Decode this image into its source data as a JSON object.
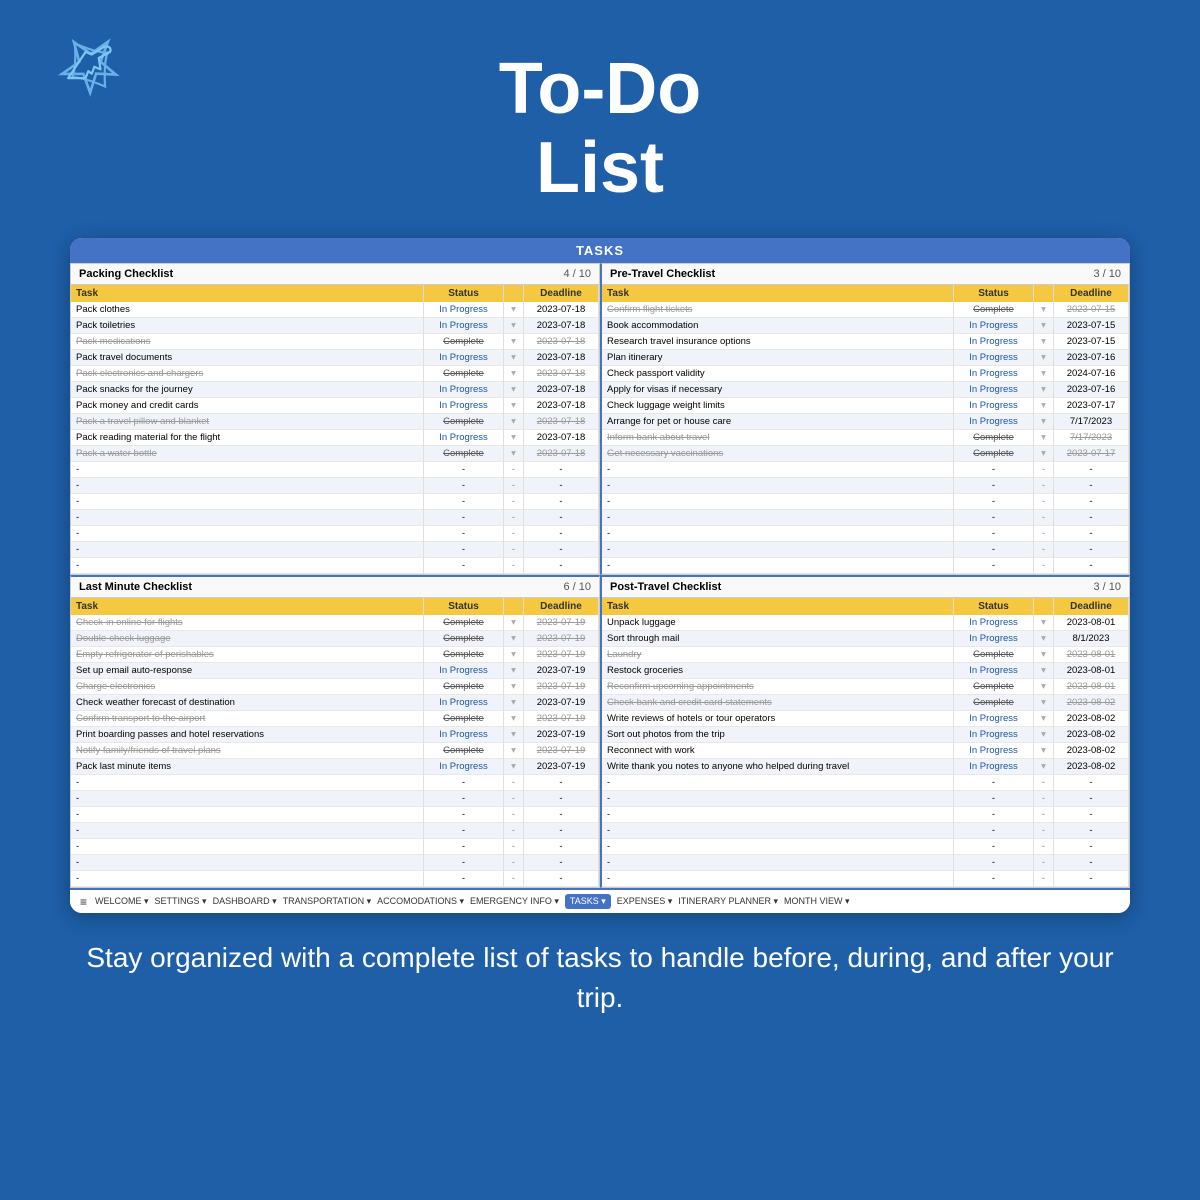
{
  "header": {
    "title_line1": "To-Do",
    "title_line2": "List"
  },
  "spreadsheet": {
    "title": "TASKS",
    "packing": {
      "label": "Packing Checklist",
      "count": "4 / 10",
      "columns": [
        "Task",
        "Status",
        "",
        "Deadline"
      ],
      "tasks": [
        {
          "name": "Pack clothes",
          "status": "In Progress",
          "deadline": "2023-07-18",
          "complete": false
        },
        {
          "name": "Pack toiletries",
          "status": "In Progress",
          "deadline": "2023-07-18",
          "complete": false
        },
        {
          "name": "Pack medications",
          "status": "Complete",
          "deadline": "2023-07-18",
          "complete": true
        },
        {
          "name": "Pack travel documents",
          "status": "In Progress",
          "deadline": "2023-07-18",
          "complete": false
        },
        {
          "name": "Pack electronics and chargers",
          "status": "Complete",
          "deadline": "2023-07-18",
          "complete": true
        },
        {
          "name": "Pack snacks for the journey",
          "status": "In Progress",
          "deadline": "2023-07-18",
          "complete": false
        },
        {
          "name": "Pack money and credit cards",
          "status": "In Progress",
          "deadline": "2023-07-18",
          "complete": false
        },
        {
          "name": "Pack a travel pillow and blanket",
          "status": "Complete",
          "deadline": "2023-07-18",
          "complete": true
        },
        {
          "name": "Pack reading material for the flight",
          "status": "In Progress",
          "deadline": "2023-07-18",
          "complete": false
        },
        {
          "name": "Pack a water bottle",
          "status": "Complete",
          "deadline": "2023-07-18",
          "complete": true
        }
      ],
      "empty_rows": 7
    },
    "pretravel": {
      "label": "Pre-Travel Checklist",
      "count": "3 / 10",
      "columns": [
        "Task",
        "Status",
        "",
        "Deadline"
      ],
      "tasks": [
        {
          "name": "Confirm flight tickets",
          "status": "Complete",
          "deadline": "2023-07-15",
          "complete": true
        },
        {
          "name": "Book accommodation",
          "status": "In Progress",
          "deadline": "2023-07-15",
          "complete": false
        },
        {
          "name": "Research travel insurance options",
          "status": "In Progress",
          "deadline": "2023-07-15",
          "complete": false
        },
        {
          "name": "Plan itinerary",
          "status": "In Progress",
          "deadline": "2023-07-16",
          "complete": false
        },
        {
          "name": "Check passport validity",
          "status": "In Progress",
          "deadline": "2024-07-16",
          "complete": false
        },
        {
          "name": "Apply for visas if necessary",
          "status": "In Progress",
          "deadline": "2023-07-16",
          "complete": false
        },
        {
          "name": "Check luggage weight limits",
          "status": "In Progress",
          "deadline": "2023-07-17",
          "complete": false
        },
        {
          "name": "Arrange for pet or house care",
          "status": "In Progress",
          "deadline": "7/17/2023",
          "complete": false
        },
        {
          "name": "Inform bank about travel",
          "status": "Complete",
          "deadline": "7/17/2023",
          "complete": true
        },
        {
          "name": "Get necessary vaccinations",
          "status": "Complete",
          "deadline": "2023-07-17",
          "complete": true
        }
      ],
      "empty_rows": 7
    },
    "lastminute": {
      "label": "Last Minute Checklist",
      "count": "6 / 10",
      "columns": [
        "Task",
        "Status",
        "",
        "Deadline"
      ],
      "tasks": [
        {
          "name": "Check-in online for flights",
          "status": "Complete",
          "deadline": "2023-07-19",
          "complete": true
        },
        {
          "name": "Double-check luggage",
          "status": "Complete",
          "deadline": "2023-07-19",
          "complete": true
        },
        {
          "name": "Empty refrigerator of perishables",
          "status": "Complete",
          "deadline": "2023-07-19",
          "complete": true
        },
        {
          "name": "Set up email auto-response",
          "status": "In Progress",
          "deadline": "2023-07-19",
          "complete": false
        },
        {
          "name": "Charge electronics",
          "status": "Complete",
          "deadline": "2023-07-19",
          "complete": true
        },
        {
          "name": "Check weather forecast of destination",
          "status": "In Progress",
          "deadline": "2023-07-19",
          "complete": false
        },
        {
          "name": "Confirm transport to the airport",
          "status": "Complete",
          "deadline": "2023-07-19",
          "complete": true
        },
        {
          "name": "Print boarding passes and hotel reservations",
          "status": "In Progress",
          "deadline": "2023-07-19",
          "complete": false
        },
        {
          "name": "Notify family/friends of travel plans",
          "status": "Complete",
          "deadline": "2023-07-19",
          "complete": true
        },
        {
          "name": "Pack last minute items",
          "status": "In Progress",
          "deadline": "2023-07-19",
          "complete": false
        }
      ],
      "empty_rows": 7
    },
    "posttravel": {
      "label": "Post-Travel Checklist",
      "count": "3 / 10",
      "columns": [
        "Task",
        "Status",
        "",
        "Deadline"
      ],
      "tasks": [
        {
          "name": "Unpack luggage",
          "status": "In Progress",
          "deadline": "2023-08-01",
          "complete": false
        },
        {
          "name": "Sort through mail",
          "status": "In Progress",
          "deadline": "8/1/2023",
          "complete": false
        },
        {
          "name": "Laundry",
          "status": "Complete",
          "deadline": "2023-08-01",
          "complete": true
        },
        {
          "name": "Restock groceries",
          "status": "In Progress",
          "deadline": "2023-08-01",
          "complete": false
        },
        {
          "name": "Reconfirm upcoming appointments",
          "status": "Complete",
          "deadline": "2023-08-01",
          "complete": true
        },
        {
          "name": "Check bank and credit card statements",
          "status": "Complete",
          "deadline": "2023-08-02",
          "complete": true
        },
        {
          "name": "Write reviews of hotels or tour operators",
          "status": "In Progress",
          "deadline": "2023-08-02",
          "complete": false
        },
        {
          "name": "Sort out photos from the trip",
          "status": "In Progress",
          "deadline": "2023-08-02",
          "complete": false
        },
        {
          "name": "Reconnect with work",
          "status": "In Progress",
          "deadline": "2023-08-02",
          "complete": false
        },
        {
          "name": "Write thank you notes to anyone who helped during travel",
          "status": "In Progress",
          "deadline": "2023-08-02",
          "complete": false
        }
      ],
      "empty_rows": 7
    }
  },
  "navbar": {
    "menu_icon": "≡",
    "items": [
      {
        "label": "WELCOME",
        "has_arrow": true,
        "active": false
      },
      {
        "label": "SETTINGS",
        "has_arrow": true,
        "active": false
      },
      {
        "label": "DASHBOARD",
        "has_arrow": true,
        "active": false
      },
      {
        "label": "TRANSPORTATION",
        "has_arrow": true,
        "active": false
      },
      {
        "label": "ACCOMODATIONS",
        "has_arrow": true,
        "active": false
      },
      {
        "label": "EMERGENCY INFO",
        "has_arrow": true,
        "active": false
      },
      {
        "label": "TASKS",
        "has_arrow": true,
        "active": true
      },
      {
        "label": "EXPENSES",
        "has_arrow": true,
        "active": false
      },
      {
        "label": "ITINERARY PLANNER",
        "has_arrow": true,
        "active": false
      },
      {
        "label": "MONTH VIEW",
        "has_arrow": true,
        "active": false
      }
    ]
  },
  "footer": {
    "text": "Stay organized with a complete list of tasks to handle before, during, and after your trip."
  }
}
